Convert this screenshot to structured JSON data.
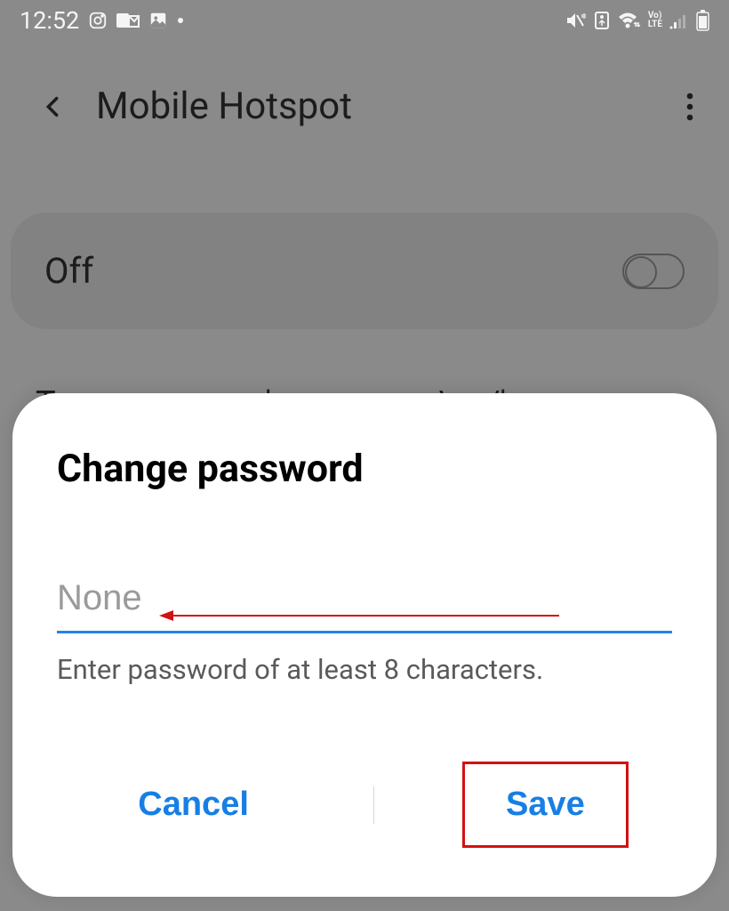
{
  "status": {
    "time": "12:52"
  },
  "header": {
    "title": "Mobile Hotspot"
  },
  "toggle": {
    "label": "Off",
    "on": false
  },
  "dialog": {
    "title": "Change password",
    "password_value": "None",
    "password_placeholder": "None",
    "hint": "Enter password of at least 8 characters.",
    "cancel_label": "Cancel",
    "save_label": "Save"
  },
  "colors": {
    "accent": "#177fe4",
    "underline": "#2384e3",
    "annotation": "#d31111"
  }
}
